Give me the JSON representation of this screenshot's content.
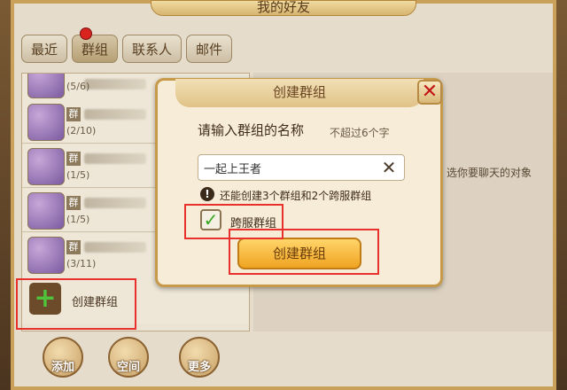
{
  "window": {
    "title": "我的好友"
  },
  "tabs": [
    {
      "label": "最近"
    },
    {
      "label": "群组"
    },
    {
      "label": "联系人"
    },
    {
      "label": "邮件"
    }
  ],
  "group_list": [
    {
      "tag": "",
      "count": "(5/6)"
    },
    {
      "tag": "群",
      "count": "(2/10)"
    },
    {
      "tag": "群",
      "count": "(1/5)"
    },
    {
      "tag": "群",
      "count": "(1/5)"
    },
    {
      "tag": "群",
      "count": "(3/11)"
    }
  ],
  "create_group_row": {
    "label": "创建群组",
    "icon": "plus-icon"
  },
  "bottom_buttons": [
    {
      "label": "添加",
      "icon": "add-friend-icon"
    },
    {
      "label": "空间",
      "icon": "house-icon"
    },
    {
      "label": "更多",
      "icon": "more-icon"
    }
  ],
  "right_panel": {
    "hint": "选你要聊天的对象"
  },
  "dialog": {
    "title": "创建群组",
    "prompt": "请输入群组的名称",
    "limit": "不超过6个字",
    "name_value": "一起上王者",
    "info": "还能创建3个群组和2个跨服群组",
    "cross_server_label": "跨服群组",
    "cross_server_checked": true,
    "create_button": "创建群组"
  },
  "colors": {
    "highlight": "#e8312d",
    "primary_button": "#f0a321",
    "check": "#36a61e"
  }
}
